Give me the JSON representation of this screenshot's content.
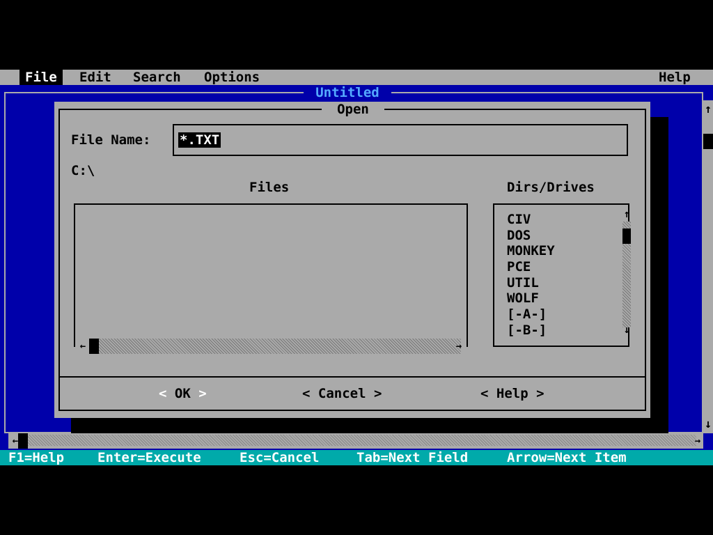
{
  "menu": {
    "items": [
      "File",
      "Edit",
      "Search",
      "Options"
    ],
    "help": "Help"
  },
  "editor": {
    "title": "Untitled",
    "scroll_up_glyph": "↑",
    "scroll_down_glyph": "↓",
    "scroll_left_glyph": "←",
    "scroll_right_glyph": "→"
  },
  "dialog": {
    "title": "Open",
    "filename_label": "File Name:",
    "filename_value": "*.TXT",
    "path": "C:\\",
    "files_heading": "Files",
    "files": [],
    "dirs_heading": "Dirs/Drives",
    "dirs": [
      "CIV",
      "DOS",
      "MONKEY",
      "PCE",
      "UTIL",
      "WOLF",
      "[-A-]",
      "[-B-]"
    ],
    "buttons": {
      "ok": "OK",
      "cancel": "Cancel",
      "help": "Help",
      "left_bracket": "<",
      "right_bracket": ">"
    }
  },
  "statusbar": {
    "items": [
      "F1=Help",
      "Enter=Execute",
      "Esc=Cancel",
      "Tab=Next Field",
      "Arrow=Next Item"
    ]
  },
  "colors": {
    "desktop": "#000000",
    "menu_bg": "#aaaaaa",
    "editor_bg": "#0000aa",
    "dialog_bg": "#aaaaaa",
    "status_bg": "#00aaaa",
    "title_text": "#55aaff"
  }
}
